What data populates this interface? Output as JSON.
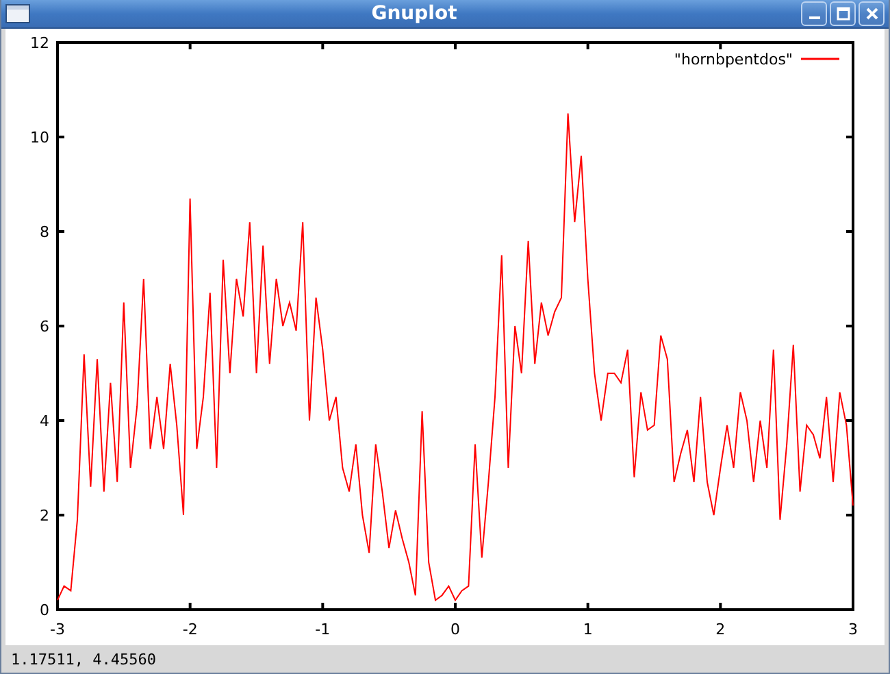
{
  "window": {
    "title": "Gnuplot"
  },
  "plot": {
    "chart_data": {
      "type": "line",
      "x": [
        -3,
        -2.95,
        -2.9,
        -2.85,
        -2.8,
        -2.75,
        -2.7,
        -2.65,
        -2.6,
        -2.55,
        -2.5,
        -2.45,
        -2.4,
        -2.35,
        -2.3,
        -2.25,
        -2.2,
        -2.15,
        -2.1,
        -2.05,
        -2,
        -1.95,
        -1.9,
        -1.85,
        -1.8,
        -1.75,
        -1.7,
        -1.65,
        -1.6,
        -1.55,
        -1.5,
        -1.45,
        -1.4,
        -1.35,
        -1.3,
        -1.25,
        -1.2,
        -1.15,
        -1.1,
        -1.05,
        -1,
        -0.95,
        -0.9,
        -0.85,
        -0.8,
        -0.75,
        -0.7,
        -0.65,
        -0.6,
        -0.55,
        -0.5,
        -0.45,
        -0.4,
        -0.35,
        -0.3,
        -0.25,
        -0.2,
        -0.15,
        -0.1,
        -0.05,
        0,
        0.05,
        0.1,
        0.15,
        0.2,
        0.25,
        0.3,
        0.35,
        0.4,
        0.45,
        0.5,
        0.55,
        0.6,
        0.65,
        0.7,
        0.75,
        0.8,
        0.85,
        0.9,
        0.95,
        1,
        1.05,
        1.1,
        1.15,
        1.2,
        1.25,
        1.3,
        1.35,
        1.4,
        1.45,
        1.5,
        1.55,
        1.6,
        1.65,
        1.7,
        1.75,
        1.8,
        1.85,
        1.9,
        1.95,
        2,
        2.05,
        2.1,
        2.15,
        2.2,
        2.25,
        2.3,
        2.35,
        2.4,
        2.45,
        2.5,
        2.55,
        2.6,
        2.65,
        2.7,
        2.75,
        2.8,
        2.85,
        2.9,
        2.95,
        3
      ],
      "series": [
        {
          "name": "\"hornbpentdos\"",
          "color": "#ff0000",
          "values": [
            0.2,
            0.5,
            0.4,
            1.9,
            5.4,
            2.6,
            5.3,
            2.5,
            4.8,
            2.7,
            6.5,
            3.0,
            4.3,
            7.0,
            3.4,
            4.5,
            3.4,
            5.2,
            3.9,
            2.0,
            8.7,
            3.4,
            4.5,
            6.7,
            3.0,
            7.4,
            5.0,
            7.0,
            6.2,
            8.2,
            5.0,
            7.7,
            5.2,
            7.0,
            6.0,
            6.5,
            5.9,
            8.2,
            4.0,
            6.6,
            5.5,
            4.0,
            4.5,
            3.0,
            2.5,
            3.5,
            2.0,
            1.2,
            3.5,
            2.5,
            1.3,
            2.1,
            1.5,
            1.0,
            0.3,
            4.2,
            1.0,
            0.2,
            0.3,
            0.5,
            0.2,
            0.4,
            0.5,
            3.5,
            1.1,
            2.7,
            4.5,
            7.5,
            3.0,
            6.0,
            5.0,
            7.8,
            5.2,
            6.5,
            5.8,
            6.3,
            6.6,
            10.5,
            8.2,
            9.6,
            7.0,
            5.0,
            4.0,
            5.0,
            5.0,
            4.8,
            5.5,
            2.8,
            4.6,
            3.8,
            3.9,
            5.8,
            5.3,
            2.7,
            3.3,
            3.8,
            2.7,
            4.5,
            2.7,
            2.0,
            3.0,
            3.9,
            3.0,
            4.6,
            4.0,
            2.7,
            4.0,
            3.0,
            5.5,
            1.9,
            3.5,
            5.6,
            2.5,
            3.9,
            3.7,
            3.2,
            4.5,
            2.7,
            4.6,
            3.9,
            2.2
          ]
        }
      ],
      "xlim": [
        -3,
        3
      ],
      "ylim": [
        0,
        12
      ],
      "xticks": [
        -3,
        -2,
        -1,
        0,
        1,
        2,
        3
      ],
      "yticks": [
        0,
        2,
        4,
        6,
        8,
        10,
        12
      ]
    }
  },
  "status_bar": {
    "text": "1.17511,  4.45560"
  }
}
